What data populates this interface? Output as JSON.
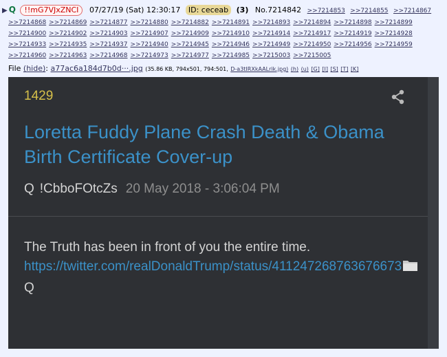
{
  "header": {
    "arrow": "▶",
    "name": "Q",
    "tripcode": "!!mG7VJxZNCI",
    "datetime": "07/27/19 (Sat) 12:30:17",
    "id": "ID: ceceab",
    "count": "(3)",
    "post_number": "No.7214842"
  },
  "replies_row1": [
    ">>7214853",
    ">>7214855",
    ">>7214867"
  ],
  "replies_rows": [
    [
      ">>7214868",
      ">>7214869",
      ">>7214877",
      ">>7214880",
      ">>7214882",
      ">>7214891",
      ">>7214893",
      ">>7214894",
      ">>7214898",
      ">>7214899"
    ],
    [
      ">>7214900",
      ">>7214902",
      ">>7214903",
      ">>7214907",
      ">>7214909",
      ">>7214910",
      ">>7214914",
      ">>7214917",
      ">>7214919",
      ">>7214928"
    ],
    [
      ">>7214933",
      ">>7214935",
      ">>7214937",
      ">>7214940",
      ">>7214945",
      ">>7214946",
      ">>7214949",
      ">>7214950",
      ">>7214956",
      ">>7214959"
    ],
    [
      ">>7214960",
      ">>7214963",
      ">>7214968",
      ">>7214973",
      ">>7214977",
      ">>7214985",
      ">>7215003",
      ">>7215005"
    ]
  ],
  "file": {
    "label": "File",
    "hide": "(hide)",
    "filename": "a77ac6a184d7b0d···.jpg",
    "meta": "(35.86 KB, 794x501, 794:501,",
    "orig": "D-a3tIRXkAALrik.jpg)",
    "links": [
      "(h)",
      "(u)",
      "[G]",
      "[I]",
      "[S]",
      "[T]",
      "[K]"
    ]
  },
  "screenshot": {
    "number": "1429",
    "title": "Loretta Fuddy Plane Crash Death & Obama Birth Certificate Cover-up",
    "author": "Q",
    "tripcode": "!CbboFOtcZs",
    "timestamp": "20 May 2018 - 3:06:04 PM",
    "body_line": "The Truth has been in front of you the entire time.",
    "link": "https://twitter.com/realDonaldTrump/status/411247268763676673",
    "sign": "Q"
  },
  "colors": {
    "background": "#eef2ff",
    "panel": "#2e3034",
    "accent_link": "#3b91c8",
    "number_yellow": "#d6c04a"
  },
  "icons": [
    "share-icon",
    "folder-icon"
  ]
}
